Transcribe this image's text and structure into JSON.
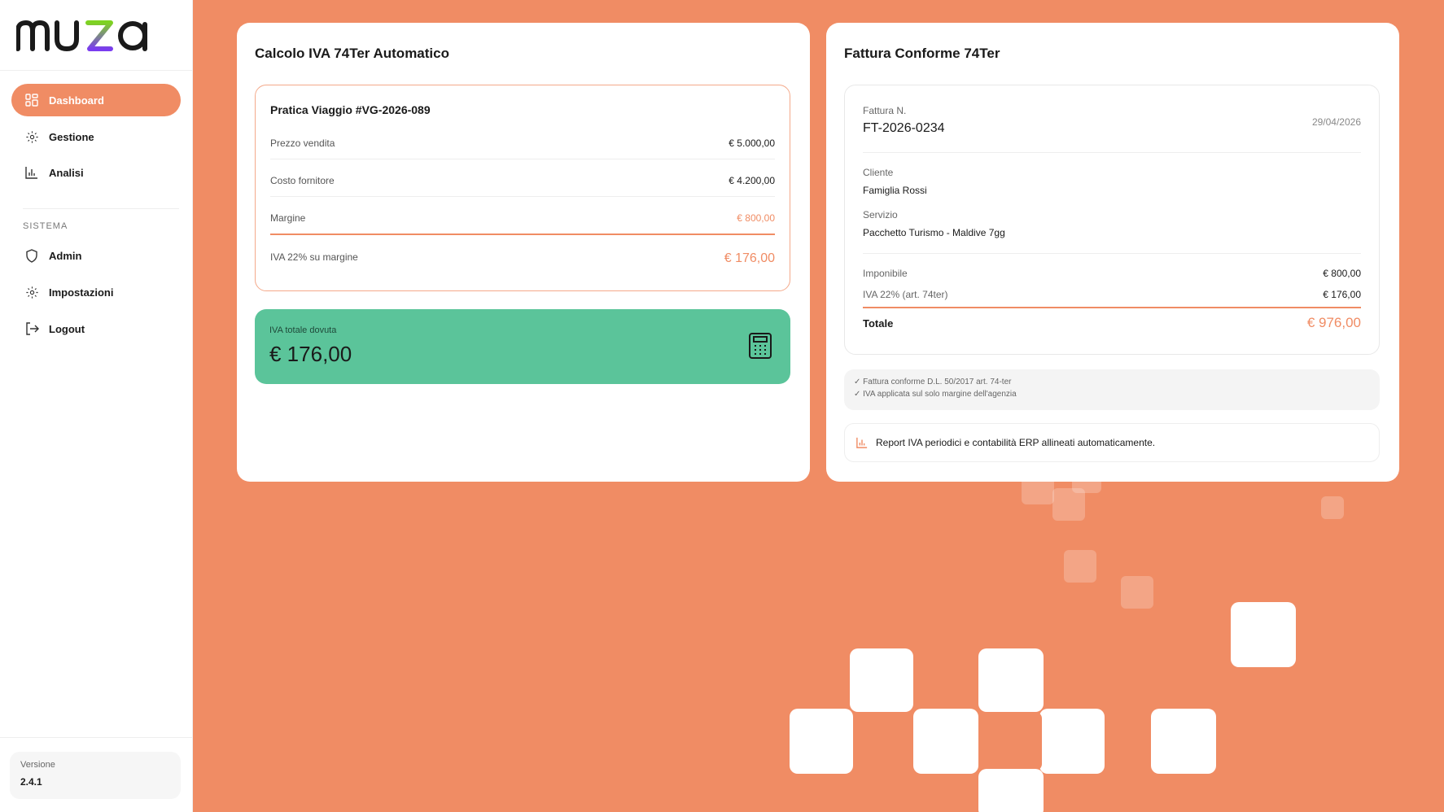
{
  "brand": {
    "logo": "muza"
  },
  "sidebar": {
    "items": [
      {
        "label": "Dashboard",
        "icon": "dashboard-icon"
      },
      {
        "label": "Gestione",
        "icon": "gear-icon"
      },
      {
        "label": "Analisi",
        "icon": "chart-icon"
      }
    ],
    "section_label": "SISTEMA",
    "system_items": [
      {
        "label": "Admin",
        "icon": "shield-icon"
      },
      {
        "label": "Impostazioni",
        "icon": "gear-icon"
      },
      {
        "label": "Logout",
        "icon": "logout-icon"
      }
    ],
    "version_label": "Versione",
    "version_value": "2.4.1"
  },
  "calc": {
    "title": "Calcolo IVA 74Ter Automatico",
    "practice_title": "Pratica Viaggio #VG-2026-089",
    "rows": [
      {
        "label": "Prezzo vendita",
        "value": "€ 5.000,00"
      },
      {
        "label": "Costo fornitore",
        "value": "€ 4.200,00"
      },
      {
        "label": "Margine",
        "value": "€ 800,00"
      }
    ],
    "iva_label": "IVA 22% su margine",
    "iva_value": "€ 176,00",
    "total_label": "IVA totale dovuta",
    "total_value": "€ 176,00"
  },
  "invoice": {
    "title": "Fattura Conforme 74Ter",
    "number_label": "Fattura N.",
    "number": "FT-2026-0234",
    "date": "29/04/2026",
    "client_label": "Cliente",
    "client": "Famiglia Rossi",
    "service_label": "Servizio",
    "service": "Pacchetto Turismo - Maldive 7gg",
    "imponibile_label": "Imponibile",
    "imponibile": "€ 800,00",
    "iva_label": "IVA 22% (art. 74ter)",
    "iva": "€ 176,00",
    "total_label": "Totale",
    "total": "€ 976,00",
    "checks": [
      "✓ Fattura conforme D.L. 50/2017 art. 74-ter",
      "✓ IVA applicata sul solo margine dell'agenzia"
    ],
    "report_text": "Report IVA periodici e contabilità ERP allineati automaticamente."
  },
  "colors": {
    "accent": "#f08c64",
    "green": "#5bc49a",
    "logo_purple": "#7a3cf0",
    "logo_green": "#7ed321"
  }
}
